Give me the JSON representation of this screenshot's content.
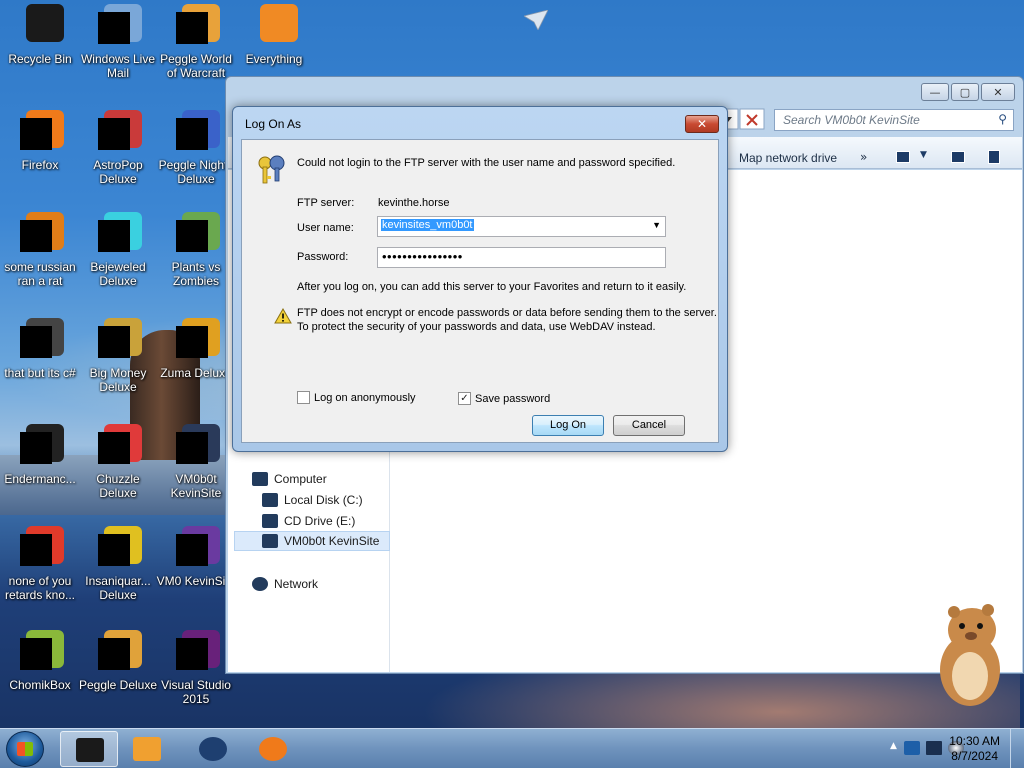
{
  "desktop": {
    "icons": [
      {
        "label": "Recycle Bin",
        "icon": "recycle-bin-icon",
        "color": "#1a1a1a"
      },
      {
        "label": "Windows Live Mail",
        "icon": "mail-icon",
        "color": "#7aa7d8"
      },
      {
        "label": "Peggle World of Warcraft",
        "icon": "peggle-icon",
        "color": "#e8a23a"
      },
      {
        "label": "Everything",
        "icon": "everything-icon",
        "color": "#f08a24"
      },
      {
        "label": "Firefox",
        "icon": "firefox-icon",
        "color": "#f07a1a"
      },
      {
        "label": "AstroPop Deluxe",
        "icon": "astropop-icon",
        "color": "#c93a3a"
      },
      {
        "label": "Peggle Nights Deluxe",
        "icon": "peggle-nights-icon",
        "color": "#3a62c9"
      },
      {
        "label": "some russian ran a rat",
        "icon": "app-icon",
        "color": "#e07d18"
      },
      {
        "label": "Bejeweled Deluxe",
        "icon": "bejeweled-icon",
        "color": "#3ad0e0"
      },
      {
        "label": "Plants vs Zombies",
        "icon": "pvz-icon",
        "color": "#6aa84f"
      },
      {
        "label": "that but its c#",
        "icon": "shortcut-icon",
        "color": "#444444"
      },
      {
        "label": "Big Money Deluxe",
        "icon": "bigmoney-icon",
        "color": "#c9a23a"
      },
      {
        "label": "Zuma Deluxe",
        "icon": "zuma-icon",
        "color": "#e0a020"
      },
      {
        "label": "Endermanc...",
        "icon": "console-icon",
        "color": "#222222"
      },
      {
        "label": "Chuzzle Deluxe",
        "icon": "chuzzle-icon",
        "color": "#e03a3a"
      },
      {
        "label": "VM0b0t KevinSite",
        "icon": "network-folder-icon",
        "color": "#2a3a5a"
      },
      {
        "label": "none of you retards kno...",
        "icon": "app-icon",
        "color": "#e03a2a"
      },
      {
        "label": "Insaniquar... Deluxe",
        "icon": "insaniquarium-icon",
        "color": "#e0c020"
      },
      {
        "label": "VM0 KevinSi...",
        "icon": "vs-icon",
        "color": "#6a3aa0"
      },
      {
        "label": "ChomikBox",
        "icon": "chomikbox-icon",
        "color": "#8ab83a"
      },
      {
        "label": "Peggle Deluxe",
        "icon": "peggle-deluxe-icon",
        "color": "#e0a23a"
      },
      {
        "label": "Visual Studio 2015",
        "icon": "visual-studio-icon",
        "color": "#68217a"
      }
    ]
  },
  "explorer": {
    "search_placeholder": "Search VM0b0t KevinSite",
    "toolbar": {
      "map_network_drive": "Map network drive",
      "more": "»"
    },
    "nav": [
      {
        "label": "Computer",
        "icon": "computer-icon"
      },
      {
        "label": "Local Disk (C:)",
        "icon": "disk-icon"
      },
      {
        "label": "CD Drive (E:)",
        "icon": "cd-drive-icon"
      },
      {
        "label": "VM0b0t KevinSite",
        "icon": "network-drive-icon"
      },
      {
        "label": "Network",
        "icon": "network-icon"
      }
    ]
  },
  "dialog": {
    "title": "Log On As",
    "message": "Could not login to the FTP server with the user name and password specified.",
    "ftp_server_label": "FTP server:",
    "ftp_server_value": "kevinthe.horse",
    "username_label": "User name:",
    "username_value": "kevinsites_vm0b0t",
    "password_label": "Password:",
    "password_value": "••••••••••••••••",
    "favorites_hint": "After you log on, you can add this server to your Favorites and return to it easily.",
    "warning": "FTP does not encrypt or encode passwords or data before sending them to the server.  To protect the security of your passwords and data, use WebDAV instead.",
    "anonymous_label": "Log on anonymously",
    "anonymous_checked": false,
    "save_password_label": "Save password",
    "save_password_checked": true,
    "logon_button": "Log On",
    "cancel_button": "Cancel"
  },
  "taskbar": {
    "pinned": [
      {
        "name": "explorer",
        "icon": "explorer-icon",
        "active": true
      },
      {
        "name": "media-player",
        "icon": "media-player-icon",
        "active": false
      },
      {
        "name": "globe",
        "icon": "globe-icon",
        "active": false
      },
      {
        "name": "firefox",
        "icon": "firefox-icon",
        "active": false
      }
    ],
    "clock_time": "10:30 AM",
    "clock_date": "8/7/2024"
  }
}
